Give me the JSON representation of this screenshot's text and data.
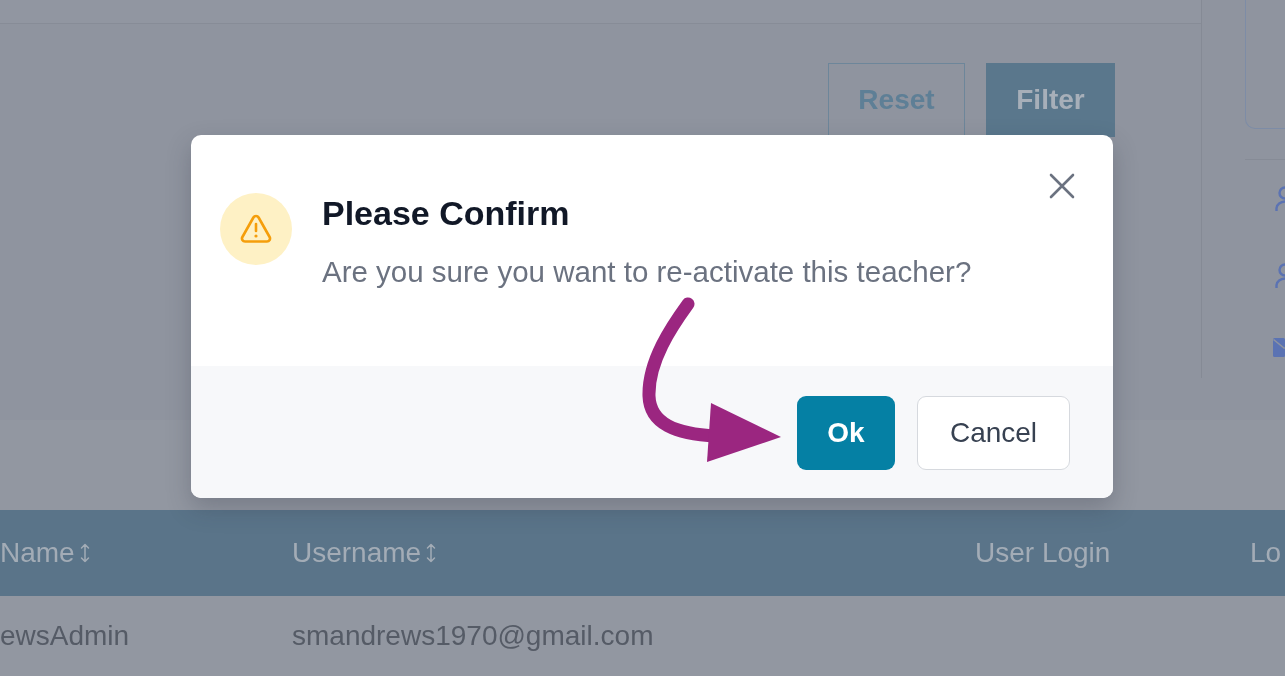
{
  "filter_panel": {
    "buttons": [
      {
        "label": "Reset",
        "kind": "outline"
      },
      {
        "label": "Filter",
        "kind": "primary"
      }
    ]
  },
  "table": {
    "columns": [
      {
        "label": "Name",
        "sortable": true
      },
      {
        "label": "Username",
        "sortable": true
      },
      {
        "label": "User Login",
        "sortable": false
      },
      {
        "label": "Lo",
        "sortable": false
      }
    ],
    "rows": [
      {
        "cells": [
          "ewsAdmin",
          "smandrews1970@gmail.com"
        ]
      }
    ]
  },
  "dialog": {
    "title": "Please Confirm",
    "message": "Are you sure you want to re-activate this teacher?",
    "buttons": [
      {
        "label": "Ok",
        "kind": "primary"
      },
      {
        "label": "Cancel",
        "kind": "secondary"
      }
    ]
  }
}
